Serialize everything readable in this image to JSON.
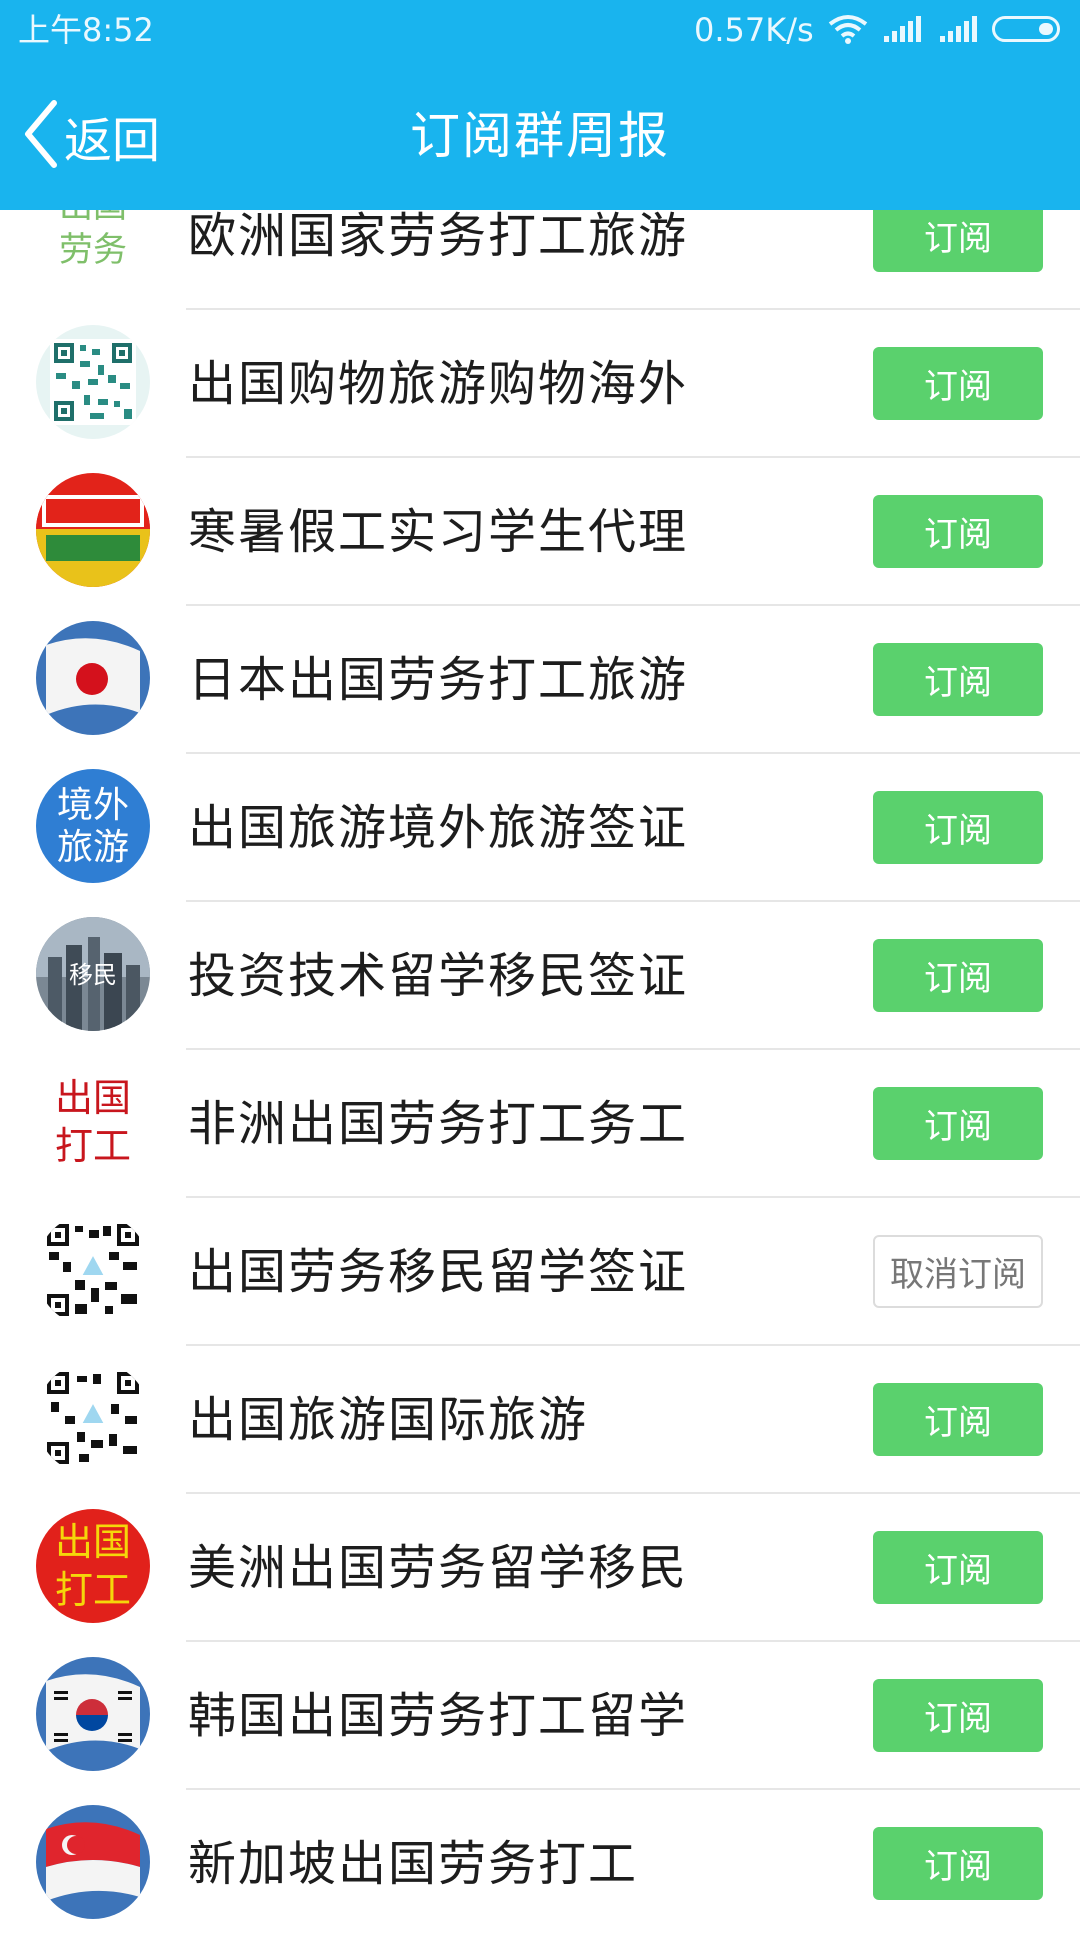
{
  "status_bar": {
    "time": "上午8:52",
    "speed": "0.57K/s"
  },
  "nav": {
    "back_label": "返回",
    "title": "订阅群周报"
  },
  "groups": [
    {
      "name": "欧洲国家劳务打工旅游",
      "button": "订阅",
      "subscribed": false,
      "avatar_text": "出国\n劳务"
    },
    {
      "name": "出国购物旅游购物海外",
      "button": "订阅",
      "subscribed": false,
      "avatar_text": ""
    },
    {
      "name": "寒暑假工实习学生代理",
      "button": "订阅",
      "subscribed": false,
      "avatar_text": ""
    },
    {
      "name": "日本出国劳务打工旅游",
      "button": "订阅",
      "subscribed": false,
      "avatar_text": ""
    },
    {
      "name": "出国旅游境外旅游签证",
      "button": "订阅",
      "subscribed": false,
      "avatar_text": "境外\n旅游"
    },
    {
      "name": "投资技术留学移民签证",
      "button": "订阅",
      "subscribed": false,
      "avatar_text": "移民"
    },
    {
      "name": "非洲出国劳务打工务工",
      "button": "订阅",
      "subscribed": false,
      "avatar_text": "出国\n打工"
    },
    {
      "name": "出国劳务移民留学签证",
      "button": "取消订阅",
      "subscribed": true,
      "avatar_text": ""
    },
    {
      "name": "出国旅游国际旅游",
      "button": "订阅",
      "subscribed": false,
      "avatar_text": ""
    },
    {
      "name": "美洲出国劳务留学移民",
      "button": "订阅",
      "subscribed": false,
      "avatar_text": "出国\n打工"
    },
    {
      "name": "韩国出国劳务打工留学",
      "button": "订阅",
      "subscribed": false,
      "avatar_text": ""
    },
    {
      "name": "新加坡出国劳务打工",
      "button": "订阅",
      "subscribed": false,
      "avatar_text": ""
    }
  ],
  "colors": {
    "header": "#19b4ee",
    "subscribe_button": "#5ad16d",
    "divider": "#e6e6e6"
  }
}
